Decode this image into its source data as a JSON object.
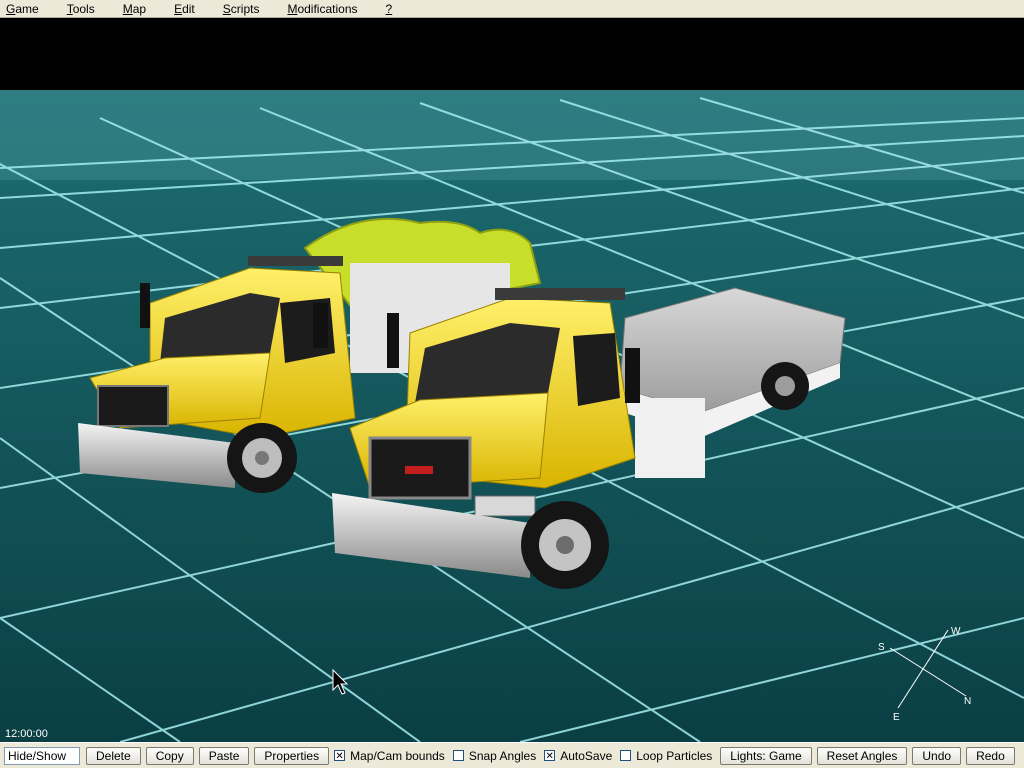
{
  "menu": {
    "items": [
      {
        "label": "Game"
      },
      {
        "label": "Tools"
      },
      {
        "label": "Map"
      },
      {
        "label": "Edit"
      },
      {
        "label": "Scripts"
      },
      {
        "label": "Modifications"
      },
      {
        "label": "?"
      }
    ]
  },
  "viewport": {
    "time": "12:00:00",
    "compass": {
      "s": "S",
      "w": "W",
      "e": "E",
      "n": "N"
    },
    "colors": {
      "grid_floor": "#0d4a4e",
      "grid_line": "#a6eef0",
      "truck_body": "#f0d21a",
      "flatbed": "#e8e8e8"
    }
  },
  "toolbar": {
    "hide_show": "Hide/Show",
    "delete": "Delete",
    "copy": "Copy",
    "paste": "Paste",
    "properties": "Properties",
    "map_cam_bounds": "Map/Cam bounds",
    "snap_angles": "Snap Angles",
    "autosave": "AutoSave",
    "loop_particles": "Loop Particles",
    "lights": "Lights: Game",
    "reset_angles": "Reset Angles",
    "undo": "Undo",
    "redo": "Redo",
    "checks": {
      "map_cam_bounds": true,
      "snap_angles": false,
      "autosave": true,
      "loop_particles": false
    }
  }
}
